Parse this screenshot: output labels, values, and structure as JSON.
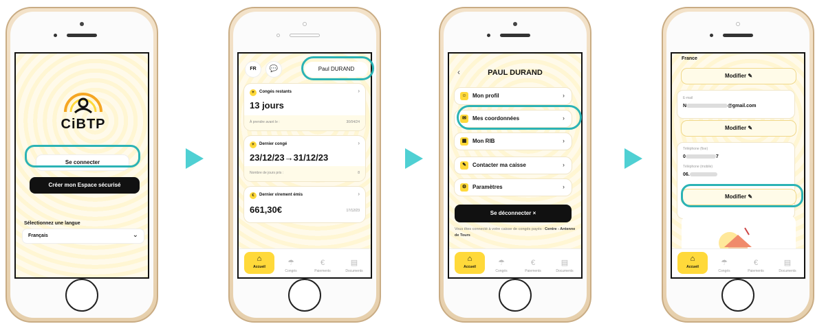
{
  "colors": {
    "accent": "#ffd93a",
    "highlight": "#2bb3b5",
    "arrow": "#4fd0d3",
    "dark": "#111111"
  },
  "phone1": {
    "logo_text": "CiBTP",
    "login_button": "Se connecter",
    "create_button": "Créer mon Espace sécurisé",
    "language_label": "Sélectionnez une langue",
    "language_value": "Français"
  },
  "phone2": {
    "lang_badge": "FR",
    "user_name": "Paul DURAND",
    "card1": {
      "title": "Congés restants",
      "value": "13 jours",
      "footer_label": "À prendre avant le :",
      "footer_value": "30/04/24"
    },
    "card2": {
      "title": "Dernier congé",
      "value": "23/12/23→31/12/23",
      "footer_label": "Nombre de jours pris :",
      "footer_value": "8"
    },
    "card3": {
      "title": "Dernier virement émis",
      "value": "661,30€",
      "footer_value": "17/12/23"
    }
  },
  "tabs": [
    "Accueil",
    "Congés",
    "Paiements",
    "Documents"
  ],
  "phone3": {
    "title": "PAUL DURAND",
    "menu": [
      "Mon profil",
      "Mes coordonnées",
      "Mon RIB",
      "Contacter ma caisse",
      "Paramètres"
    ],
    "logout": "Se déconnecter",
    "footer_text": "Vous êtes connecté à votre caisse de congés payés : ",
    "footer_caisse": "Centre - Antenne de Tours"
  },
  "phone4": {
    "country": "France",
    "modify": "Modifier",
    "email_label": "E-mail",
    "email_prefix": "N",
    "email_suffix": "@gmail.com",
    "phone_fixe_label": "Téléphone (fixe)",
    "phone_fixe_prefix": "0",
    "phone_fixe_suffix": "7",
    "phone_mobile_label": "Téléphone (mobile)",
    "phone_mobile_prefix": "06."
  }
}
